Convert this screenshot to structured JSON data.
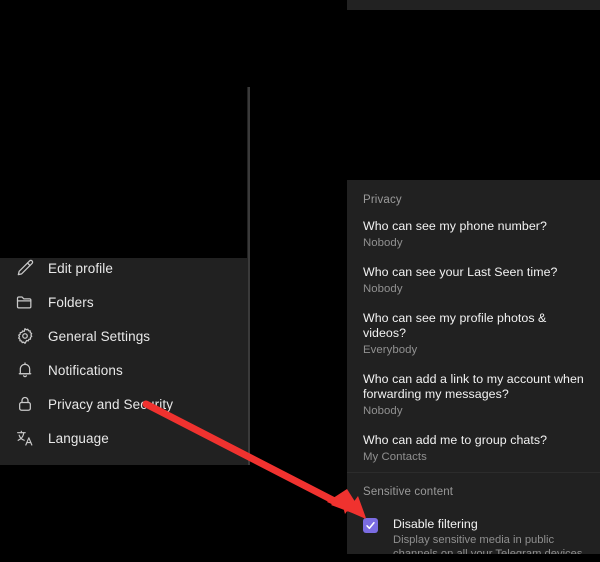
{
  "window": {
    "background_color": "#000000",
    "panel_color": "#212121"
  },
  "settings_menu": {
    "items": [
      {
        "label": "Edit profile",
        "icon": "pencil-icon"
      },
      {
        "label": "Folders",
        "icon": "folder-icon"
      },
      {
        "label": "General Settings",
        "icon": "gear-icon"
      },
      {
        "label": "Notifications",
        "icon": "bell-icon"
      },
      {
        "label": "Privacy and Security",
        "icon": "lock-icon"
      },
      {
        "label": "Language",
        "icon": "translate-icon"
      }
    ]
  },
  "privacy_panel": {
    "section_title": "Privacy",
    "rows": [
      {
        "question": "Who can see my phone number?",
        "value": "Nobody"
      },
      {
        "question": "Who can see your Last Seen time?",
        "value": "Nobody"
      },
      {
        "question": "Who can see my profile photos & videos?",
        "value": "Everybody"
      },
      {
        "question": "Who can add a link to my account when forwarding my messages?",
        "value": "Nobody"
      },
      {
        "question": "Who can add me to group chats?",
        "value": "My Contacts"
      }
    ]
  },
  "sensitive_content": {
    "section_title": "Sensitive content",
    "checkbox": {
      "checked": true,
      "color": "#7b6ce2",
      "label": "Disable filtering",
      "description": "Display sensitive media in public channels on all your Telegram devices."
    }
  },
  "annotation": {
    "arrow_color": "#f0322f",
    "points_to": "disable-filtering-checkbox"
  }
}
